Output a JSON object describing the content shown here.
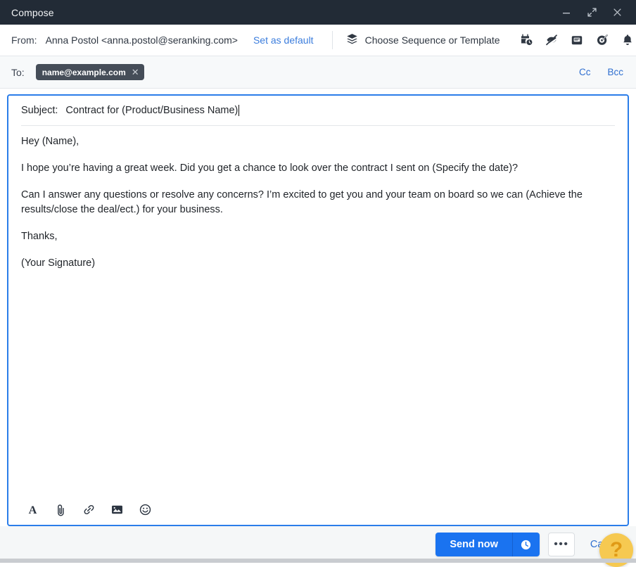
{
  "window": {
    "title": "Compose",
    "controls": [
      {
        "name": "minimize-button",
        "icon": "minimize-icon"
      },
      {
        "name": "expand-button",
        "icon": "expand-icon"
      },
      {
        "name": "close-button",
        "icon": "close-icon"
      }
    ]
  },
  "from": {
    "label": "From:",
    "value": "Anna Postol <anna.postol@seranking.com>",
    "set_as_default": "Set as default"
  },
  "toolbar": {
    "sequence_label": "Choose Sequence or Template",
    "sequence_icon": "layers-icon",
    "icons": [
      {
        "name": "schedule-send-icon",
        "title": "Schedule"
      },
      {
        "name": "tracking-off-icon",
        "title": "Tracking off"
      },
      {
        "name": "inbox-open-icon",
        "title": "Open tracking"
      },
      {
        "name": "target-icon",
        "title": "Goal"
      },
      {
        "name": "bell-icon",
        "title": "Reminder"
      }
    ]
  },
  "to": {
    "label": "To:",
    "recipients": [
      {
        "email": "name@example.com",
        "remove_icon": "close-icon"
      }
    ],
    "cc_label": "Cc",
    "bcc_label": "Bcc"
  },
  "subject": {
    "label": "Subject:",
    "value": "Contract for (Product/Business Name)"
  },
  "body": {
    "paragraphs": [
      "Hey (Name),",
      "I hope you’re having a great week. Did you get a chance to look over the contract I sent on (Specify the date)?",
      "Can I answer any questions or resolve any concerns? I’m excited to get you and your team on board so we can (Achieve the results/close the deal/ect.) for your business.",
      "Thanks,",
      "(Your Signature)"
    ]
  },
  "editor_toolbar": {
    "icons": [
      {
        "name": "formatting-icon",
        "label": "A"
      },
      {
        "name": "attachment-icon",
        "label": "paperclip"
      },
      {
        "name": "link-icon",
        "label": "link"
      },
      {
        "name": "image-icon",
        "label": "image"
      },
      {
        "name": "emoji-icon",
        "label": "emoji"
      }
    ]
  },
  "footer": {
    "send_label": "Send now",
    "send_schedule_icon": "clock-icon",
    "more_label": "•••",
    "cancel_label": "Cancel",
    "help_label": "?"
  },
  "colors": {
    "titlebar_bg": "#222b36",
    "accent_blue": "#1a73f0",
    "link_blue": "#2f6fd0",
    "compose_border": "#2b7de9",
    "chip_bg": "#454d58",
    "help_yellow": "#f6c951"
  }
}
